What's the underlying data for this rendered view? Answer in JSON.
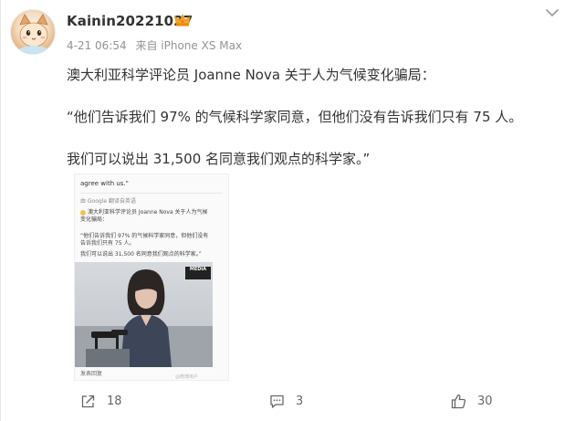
{
  "post": {
    "author": {
      "username": "Kainin20221027",
      "avatar_icon": "cat-avatar",
      "badge_icon": "crown-icon"
    },
    "meta": {
      "date": "4-21 06:54",
      "source": "来自 iPhone XS Max"
    },
    "menu_icon": "chevron-down-icon",
    "text_lines": [
      "澳大利亚科学评论员 Joanne Nova 关于人为气候变化骗局：",
      "“他们告诉我们 97% 的气候科学家同意，但他们没有告诉我们只有 75 人。",
      "我们可以说出 31,500 名同意我们观点的科学家。”"
    ],
    "media": {
      "lines": [
        "agree with us.\"",
        "由 Google 翻译自英语",
        "澳大利亚科学评论员 Joanne Nova 关于人为气候",
        "变化骗局：",
        "“他们告诉我们 97% 的气候科学家同意，但他们没有",
        "告诉我们只有 75 人。",
        "我们可以说出 31,500 名同意我们观点的科学家。”"
      ],
      "video_tag": "MEDIA",
      "footer": "发表回复",
      "watermark": "@微博用户"
    },
    "actions": {
      "share_count": "18",
      "comment_count": "3",
      "like_count": "30",
      "share_icon": "share-icon",
      "comment_icon": "comment-icon",
      "like_icon": "thumbs-up-icon"
    }
  }
}
